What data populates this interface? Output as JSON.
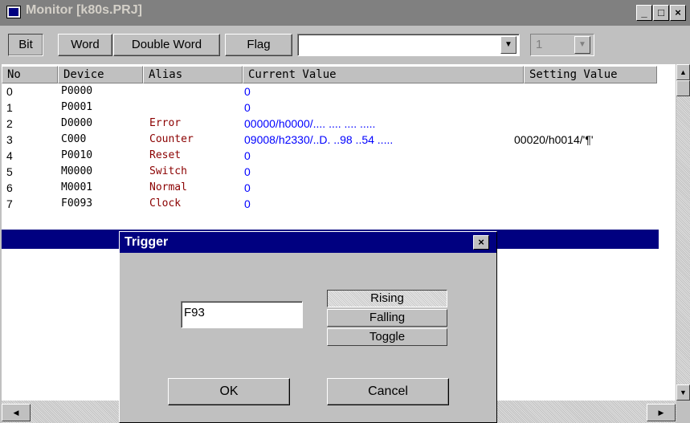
{
  "window": {
    "title": "Monitor [k80s.PRJ]",
    "minimize_glyph": "_",
    "maximize_glyph": "□",
    "close_glyph": "×"
  },
  "toolbar": {
    "tabs": [
      "Bit",
      "Word",
      "Double Word",
      "Flag"
    ],
    "device_combo_value": "",
    "count_combo_value": "1",
    "dropdown_glyph": "▼"
  },
  "table": {
    "headers": [
      "No",
      "Device",
      "Alias",
      "Current Value",
      "Setting Value"
    ],
    "rows": [
      {
        "no": "0",
        "device": "P0000",
        "alias": "",
        "current": "0",
        "setting": ""
      },
      {
        "no": "1",
        "device": "P0001",
        "alias": "",
        "current": "0",
        "setting": ""
      },
      {
        "no": "2",
        "device": "D0000",
        "alias": "Error",
        "current": "00000/h0000/.... .... .... .....",
        "setting": ""
      },
      {
        "no": "3",
        "device": "C000",
        "alias": "Counter",
        "current": "09008/h2330/..D. ..98 ..54 .....",
        "setting": "00020/h0014/'¶'"
      },
      {
        "no": "4",
        "device": "P0010",
        "alias": "Reset",
        "current": "0",
        "setting": ""
      },
      {
        "no": "5",
        "device": "M0000",
        "alias": "Switch",
        "current": "0",
        "setting": ""
      },
      {
        "no": "6",
        "device": "M0001",
        "alias": "Normal",
        "current": "0",
        "setting": ""
      },
      {
        "no": "7",
        "device": "F0093",
        "alias": "Clock",
        "current": "0",
        "setting": ""
      }
    ]
  },
  "dialog": {
    "title": "Trigger",
    "close_glyph": "×",
    "input_value": "F93",
    "options": [
      "Rising",
      "Falling",
      "Toggle"
    ],
    "selected_option": "Rising",
    "ok_label": "OK",
    "cancel_label": "Cancel"
  },
  "scroll": {
    "up": "▲",
    "down": "▼",
    "left": "◀",
    "right": "▶"
  }
}
